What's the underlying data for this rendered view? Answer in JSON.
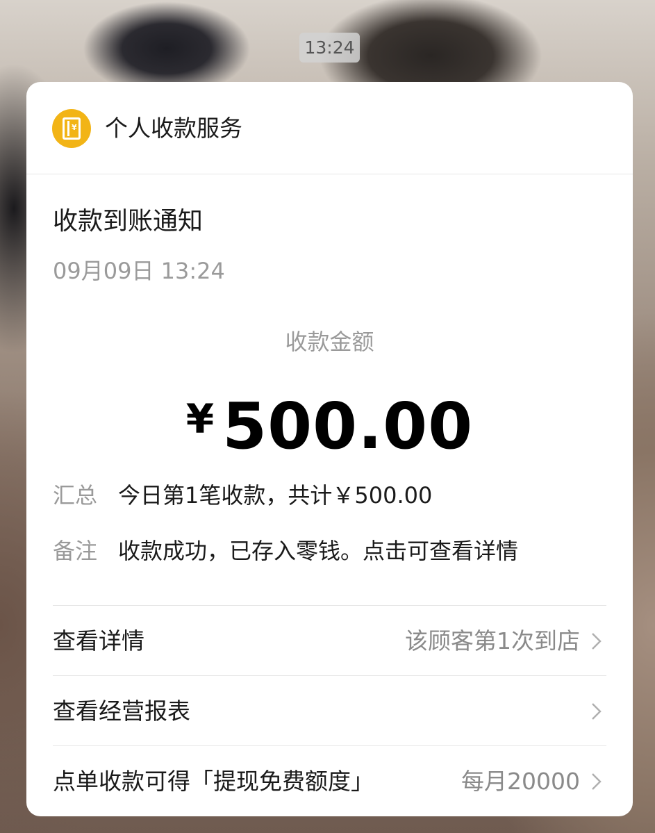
{
  "timestamp_pill": "13:24",
  "card": {
    "app_name": "个人收款服务",
    "app_icon": "ledger-yen-icon",
    "accent_color": "#f2b416",
    "title": "收款到账通知",
    "datetime": "09月09日 13:24",
    "amount_label": "收款金额",
    "amount_currency": "¥",
    "amount_value": "500.00",
    "summary_key": "汇总",
    "summary_value": "今日第1笔收款，共计￥500.00",
    "note_key": "备注",
    "note_value": "收款成功，已存入零钱。点击可查看详情",
    "items": [
      {
        "label": "查看详情",
        "extra": "该顾客第1次到店"
      },
      {
        "label": "查看经营报表",
        "extra": ""
      },
      {
        "label": "点单收款可得「提现免费额度」",
        "extra": "每月20000"
      }
    ]
  }
}
